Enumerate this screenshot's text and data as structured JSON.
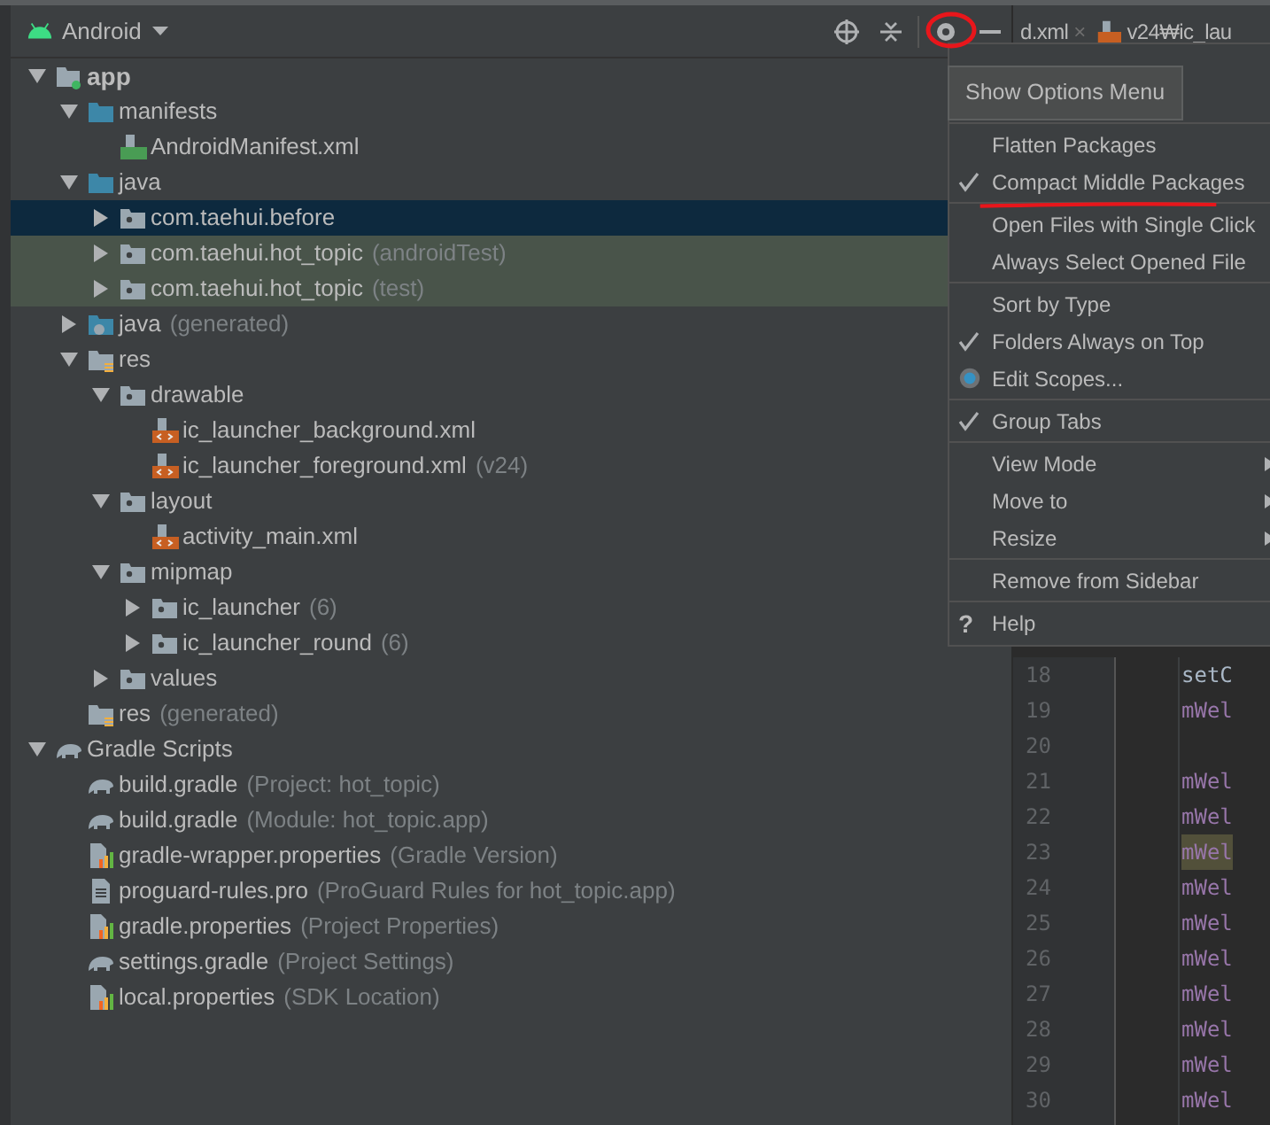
{
  "project_view": {
    "title": "Android",
    "tree": [
      {
        "label": "app",
        "kind": "module",
        "expanded": true,
        "selected": false,
        "test_source": false,
        "children": [
          {
            "label": "manifests",
            "kind": "source_folder",
            "expanded": true,
            "selected": false,
            "test_source": false,
            "children": [
              {
                "label": "AndroidManifest.xml",
                "kind": "manifest",
                "selected": false,
                "test_source": false
              }
            ]
          },
          {
            "label": "java",
            "kind": "source_folder",
            "expanded": true,
            "selected": false,
            "test_source": false,
            "children": [
              {
                "label": "com.taehui.before",
                "kind": "package",
                "expanded": false,
                "selected": true,
                "test_source": false
              },
              {
                "label": "com.taehui.hot_topic",
                "detail": "(androidTest)",
                "kind": "package",
                "expanded": false,
                "selected": false,
                "test_source": true
              },
              {
                "label": "com.taehui.hot_topic",
                "detail": "(test)",
                "kind": "package",
                "expanded": false,
                "selected": false,
                "test_source": true
              }
            ]
          },
          {
            "label": "java",
            "detail": "(generated)",
            "kind": "generated_folder",
            "expanded": false,
            "selected": false,
            "test_source": false
          },
          {
            "label": "res",
            "kind": "res_folder",
            "expanded": true,
            "selected": false,
            "test_source": false,
            "children": [
              {
                "label": "drawable",
                "kind": "package",
                "expanded": true,
                "selected": false,
                "test_source": false,
                "children": [
                  {
                    "label": "ic_launcher_background.xml",
                    "kind": "xml",
                    "selected": false,
                    "test_source": false
                  },
                  {
                    "label": "ic_launcher_foreground.xml",
                    "detail": "(v24)",
                    "kind": "xml",
                    "selected": false,
                    "test_source": false
                  }
                ]
              },
              {
                "label": "layout",
                "kind": "package",
                "expanded": true,
                "selected": false,
                "test_source": false,
                "children": [
                  {
                    "label": "activity_main.xml",
                    "kind": "xml",
                    "selected": false,
                    "test_source": false
                  }
                ]
              },
              {
                "label": "mipmap",
                "kind": "package",
                "expanded": true,
                "selected": false,
                "test_source": false,
                "children": [
                  {
                    "label": "ic_launcher",
                    "detail": "(6)",
                    "kind": "package",
                    "expanded": false,
                    "selected": false,
                    "test_source": false
                  },
                  {
                    "label": "ic_launcher_round",
                    "detail": "(6)",
                    "kind": "package",
                    "expanded": false,
                    "selected": false,
                    "test_source": false
                  }
                ]
              },
              {
                "label": "values",
                "kind": "package",
                "expanded": false,
                "selected": false,
                "test_source": false
              }
            ]
          },
          {
            "label": "res",
            "detail": "(generated)",
            "kind": "res_folder",
            "selected": false,
            "test_source": false
          }
        ]
      },
      {
        "label": "Gradle Scripts",
        "kind": "gradle",
        "expanded": true,
        "selected": false,
        "test_source": false,
        "children": [
          {
            "label": "build.gradle",
            "detail": "(Project: hot_topic)",
            "kind": "gradle",
            "selected": false,
            "test_source": false
          },
          {
            "label": "build.gradle",
            "detail": "(Module: hot_topic.app)",
            "kind": "gradle",
            "selected": false,
            "test_source": false
          },
          {
            "label": "gradle-wrapper.properties",
            "detail": "(Gradle Version)",
            "kind": "properties",
            "selected": false,
            "test_source": false
          },
          {
            "label": "proguard-rules.pro",
            "detail": "(ProGuard Rules for hot_topic.app)",
            "kind": "text",
            "selected": false,
            "test_source": false
          },
          {
            "label": "gradle.properties",
            "detail": "(Project Properties)",
            "kind": "properties",
            "selected": false,
            "test_source": false
          },
          {
            "label": "settings.gradle",
            "detail": "(Project Settings)",
            "kind": "gradle",
            "selected": false,
            "test_source": false
          },
          {
            "label": "local.properties",
            "detail": "(SDK Location)",
            "kind": "properties",
            "selected": false,
            "test_source": false
          }
        ]
      }
    ]
  },
  "editor": {
    "tabs": [
      {
        "label": "d.xml",
        "kind": "plain",
        "close": "×"
      },
      {
        "label": "v24₩ic_lau",
        "kind": "xml"
      }
    ],
    "lines": [
      {
        "number": "18",
        "code": "setC",
        "kind": "call"
      },
      {
        "number": "19",
        "code": "mWel",
        "kind": "field"
      },
      {
        "number": "20",
        "kind": "blank"
      },
      {
        "number": "21",
        "code": "mWel",
        "kind": "field"
      },
      {
        "number": "22",
        "code": "mWel",
        "kind": "field"
      },
      {
        "number": "23",
        "code": "mWel",
        "kind": "field",
        "highlighted": true
      },
      {
        "number": "24",
        "code": "mWel",
        "kind": "field"
      },
      {
        "number": "25",
        "code": "mWel",
        "kind": "field"
      },
      {
        "number": "26",
        "code": "mWel",
        "kind": "field"
      },
      {
        "number": "27",
        "code": "mWel",
        "kind": "field"
      },
      {
        "number": "28",
        "code": "mWel",
        "kind": "field"
      },
      {
        "number": "29",
        "code": "mWel",
        "kind": "field"
      },
      {
        "number": "30",
        "code": "mWel",
        "kind": "field"
      }
    ]
  },
  "options_menu": {
    "tooltip": "Show Options Menu",
    "groups": [
      [
        {
          "label": "Flatten Packages",
          "kind": "toggle",
          "checked": false
        },
        {
          "label": "Compact Middle Packages",
          "kind": "toggle",
          "checked": true
        }
      ],
      [
        {
          "label": "Open Files with Single Click",
          "kind": "toggle",
          "checked": false
        },
        {
          "label": "Always Select Opened File",
          "kind": "toggle",
          "checked": false
        }
      ],
      [
        {
          "label": "Sort by Type",
          "kind": "toggle",
          "checked": false
        },
        {
          "label": "Folders Always on Top",
          "kind": "toggle",
          "checked": true
        },
        {
          "label": "Edit Scopes...",
          "kind": "scopes"
        }
      ],
      [
        {
          "label": "Group Tabs",
          "kind": "toggle",
          "checked": true
        }
      ],
      [
        {
          "label": "View Mode",
          "kind": "submenu"
        },
        {
          "label": "Move to",
          "kind": "submenu"
        },
        {
          "label": "Resize",
          "kind": "submenu"
        }
      ],
      [
        {
          "label": "Remove from Sidebar",
          "kind": "action"
        }
      ],
      [
        {
          "label": "Help",
          "kind": "help",
          "icon": "?"
        }
      ]
    ]
  }
}
